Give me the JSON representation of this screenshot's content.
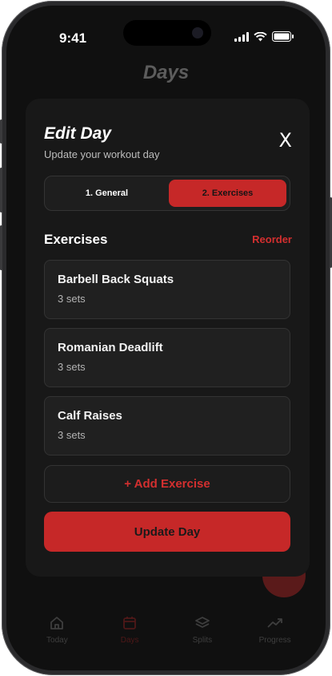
{
  "status_bar": {
    "time": "9:41"
  },
  "background": {
    "title": "Days",
    "tabs": [
      {
        "label": "Today",
        "icon": "home-icon"
      },
      {
        "label": "Days",
        "icon": "calendar-icon"
      },
      {
        "label": "Splits",
        "icon": "layers-icon"
      },
      {
        "label": "Progress",
        "icon": "trending-up-icon"
      }
    ],
    "active_tab": "Days"
  },
  "modal": {
    "title": "Edit Day",
    "subtitle": "Update your workout day",
    "close_label": "X",
    "tabs": [
      {
        "label": "1. General",
        "selected": false
      },
      {
        "label": "2. Exercises",
        "selected": true
      }
    ],
    "section_title": "Exercises",
    "reorder_label": "Reorder",
    "exercises": [
      {
        "name": "Barbell Back Squats",
        "sets": "3 sets"
      },
      {
        "name": "Romanian Deadlift",
        "sets": "3 sets"
      },
      {
        "name": "Calf Raises",
        "sets": "3 sets"
      }
    ],
    "add_label": "+ Add Exercise",
    "update_label": "Update Day"
  },
  "colors": {
    "accent": "#c62828",
    "accent_text": "#d32f2f",
    "surface": "#181818",
    "card": "#202020"
  }
}
